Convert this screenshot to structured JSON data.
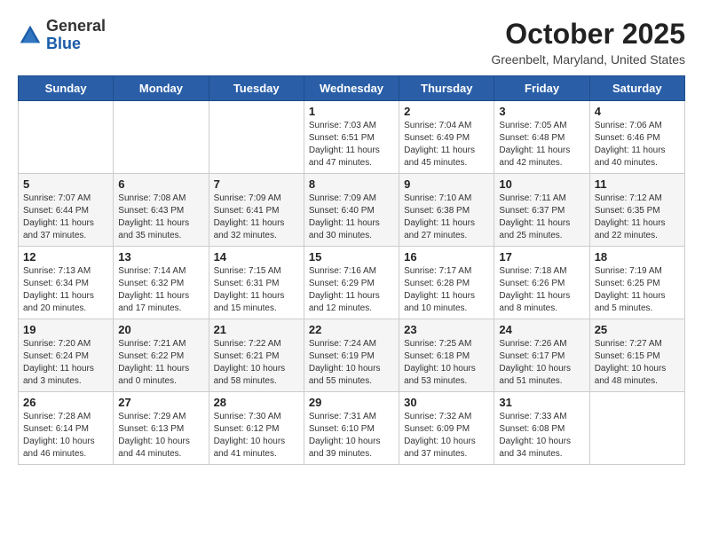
{
  "header": {
    "logo_general": "General",
    "logo_blue": "Blue",
    "month": "October 2025",
    "location": "Greenbelt, Maryland, United States"
  },
  "days_of_week": [
    "Sunday",
    "Monday",
    "Tuesday",
    "Wednesday",
    "Thursday",
    "Friday",
    "Saturday"
  ],
  "weeks": [
    [
      {
        "day": "",
        "info": ""
      },
      {
        "day": "",
        "info": ""
      },
      {
        "day": "",
        "info": ""
      },
      {
        "day": "1",
        "info": "Sunrise: 7:03 AM\nSunset: 6:51 PM\nDaylight: 11 hours\nand 47 minutes."
      },
      {
        "day": "2",
        "info": "Sunrise: 7:04 AM\nSunset: 6:49 PM\nDaylight: 11 hours\nand 45 minutes."
      },
      {
        "day": "3",
        "info": "Sunrise: 7:05 AM\nSunset: 6:48 PM\nDaylight: 11 hours\nand 42 minutes."
      },
      {
        "day": "4",
        "info": "Sunrise: 7:06 AM\nSunset: 6:46 PM\nDaylight: 11 hours\nand 40 minutes."
      }
    ],
    [
      {
        "day": "5",
        "info": "Sunrise: 7:07 AM\nSunset: 6:44 PM\nDaylight: 11 hours\nand 37 minutes."
      },
      {
        "day": "6",
        "info": "Sunrise: 7:08 AM\nSunset: 6:43 PM\nDaylight: 11 hours\nand 35 minutes."
      },
      {
        "day": "7",
        "info": "Sunrise: 7:09 AM\nSunset: 6:41 PM\nDaylight: 11 hours\nand 32 minutes."
      },
      {
        "day": "8",
        "info": "Sunrise: 7:09 AM\nSunset: 6:40 PM\nDaylight: 11 hours\nand 30 minutes."
      },
      {
        "day": "9",
        "info": "Sunrise: 7:10 AM\nSunset: 6:38 PM\nDaylight: 11 hours\nand 27 minutes."
      },
      {
        "day": "10",
        "info": "Sunrise: 7:11 AM\nSunset: 6:37 PM\nDaylight: 11 hours\nand 25 minutes."
      },
      {
        "day": "11",
        "info": "Sunrise: 7:12 AM\nSunset: 6:35 PM\nDaylight: 11 hours\nand 22 minutes."
      }
    ],
    [
      {
        "day": "12",
        "info": "Sunrise: 7:13 AM\nSunset: 6:34 PM\nDaylight: 11 hours\nand 20 minutes."
      },
      {
        "day": "13",
        "info": "Sunrise: 7:14 AM\nSunset: 6:32 PM\nDaylight: 11 hours\nand 17 minutes."
      },
      {
        "day": "14",
        "info": "Sunrise: 7:15 AM\nSunset: 6:31 PM\nDaylight: 11 hours\nand 15 minutes."
      },
      {
        "day": "15",
        "info": "Sunrise: 7:16 AM\nSunset: 6:29 PM\nDaylight: 11 hours\nand 12 minutes."
      },
      {
        "day": "16",
        "info": "Sunrise: 7:17 AM\nSunset: 6:28 PM\nDaylight: 11 hours\nand 10 minutes."
      },
      {
        "day": "17",
        "info": "Sunrise: 7:18 AM\nSunset: 6:26 PM\nDaylight: 11 hours\nand 8 minutes."
      },
      {
        "day": "18",
        "info": "Sunrise: 7:19 AM\nSunset: 6:25 PM\nDaylight: 11 hours\nand 5 minutes."
      }
    ],
    [
      {
        "day": "19",
        "info": "Sunrise: 7:20 AM\nSunset: 6:24 PM\nDaylight: 11 hours\nand 3 minutes."
      },
      {
        "day": "20",
        "info": "Sunrise: 7:21 AM\nSunset: 6:22 PM\nDaylight: 11 hours\nand 0 minutes."
      },
      {
        "day": "21",
        "info": "Sunrise: 7:22 AM\nSunset: 6:21 PM\nDaylight: 10 hours\nand 58 minutes."
      },
      {
        "day": "22",
        "info": "Sunrise: 7:24 AM\nSunset: 6:19 PM\nDaylight: 10 hours\nand 55 minutes."
      },
      {
        "day": "23",
        "info": "Sunrise: 7:25 AM\nSunset: 6:18 PM\nDaylight: 10 hours\nand 53 minutes."
      },
      {
        "day": "24",
        "info": "Sunrise: 7:26 AM\nSunset: 6:17 PM\nDaylight: 10 hours\nand 51 minutes."
      },
      {
        "day": "25",
        "info": "Sunrise: 7:27 AM\nSunset: 6:15 PM\nDaylight: 10 hours\nand 48 minutes."
      }
    ],
    [
      {
        "day": "26",
        "info": "Sunrise: 7:28 AM\nSunset: 6:14 PM\nDaylight: 10 hours\nand 46 minutes."
      },
      {
        "day": "27",
        "info": "Sunrise: 7:29 AM\nSunset: 6:13 PM\nDaylight: 10 hours\nand 44 minutes."
      },
      {
        "day": "28",
        "info": "Sunrise: 7:30 AM\nSunset: 6:12 PM\nDaylight: 10 hours\nand 41 minutes."
      },
      {
        "day": "29",
        "info": "Sunrise: 7:31 AM\nSunset: 6:10 PM\nDaylight: 10 hours\nand 39 minutes."
      },
      {
        "day": "30",
        "info": "Sunrise: 7:32 AM\nSunset: 6:09 PM\nDaylight: 10 hours\nand 37 minutes."
      },
      {
        "day": "31",
        "info": "Sunrise: 7:33 AM\nSunset: 6:08 PM\nDaylight: 10 hours\nand 34 minutes."
      },
      {
        "day": "",
        "info": ""
      }
    ]
  ]
}
